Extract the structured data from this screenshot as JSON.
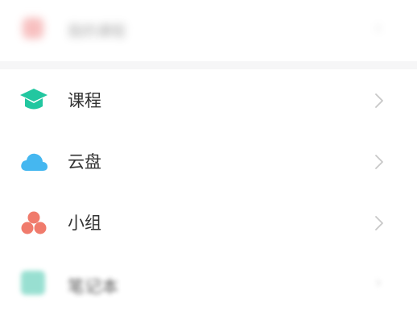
{
  "top_item": {
    "label": "我的课程",
    "icon": "blurred-red-icon",
    "chevron": "›",
    "colors": {
      "icon": "#f7b6b6"
    }
  },
  "menu": {
    "items": [
      {
        "label": "课程",
        "icon": "graduation-cap-icon",
        "color": "#22c7a0"
      },
      {
        "label": "云盘",
        "icon": "cloud-icon",
        "color": "#45b7f0"
      },
      {
        "label": "小组",
        "icon": "group-icon",
        "color": "#f07b6c"
      }
    ]
  },
  "bottom_item": {
    "label": "笔记本",
    "icon": "notebook-icon",
    "chevron": "›",
    "colors": {
      "icon": "#7fd8c6"
    }
  },
  "colors": {
    "text": "#333333",
    "chevron": "#c8c8c8",
    "background": "#ffffff",
    "separator": "#f6f6f7"
  }
}
